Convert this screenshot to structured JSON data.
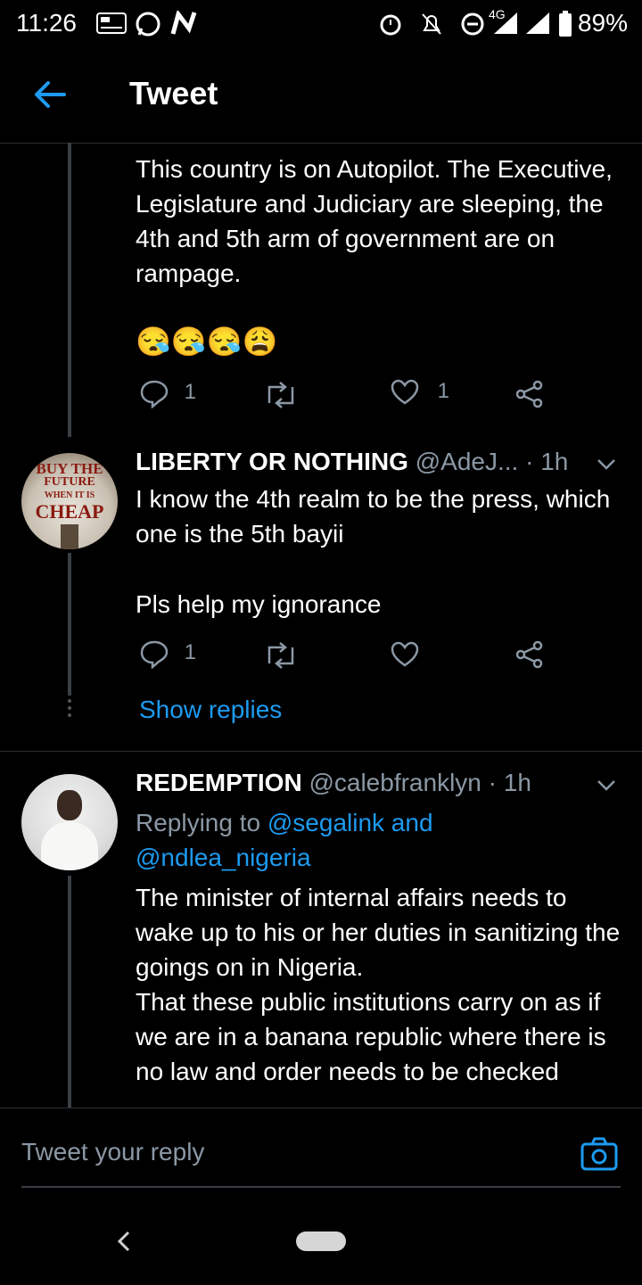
{
  "status_bar": {
    "time": "11:26",
    "network": "4G",
    "battery": "89%"
  },
  "header": {
    "title": "Tweet"
  },
  "tweet_main": {
    "text": "This country is on Autopilot. The Executive, Legislature and Judiciary are sleeping, the 4th and 5th arm of government are on rampage.",
    "emojis": "😪😪😪😩",
    "reply_count": "1",
    "like_count": "1"
  },
  "tweet_liberty": {
    "display_name": "LIBERTY OR NOTHING",
    "handle": "@AdeJ...",
    "time": "1h",
    "avatar_text": [
      "BUY THE",
      "FUTURE",
      "WHEN IT IS",
      "CHEAP"
    ],
    "text_1": "I know the 4th realm to be the press, which one is the 5th bayii",
    "text_2": "Pls help my ignorance",
    "reply_count": "1",
    "show_replies": "Show replies"
  },
  "tweet_redemption": {
    "display_name": "REDEMPTION",
    "handle": "@calebfranklyn",
    "time": "1h",
    "replying_prefix": "Replying to",
    "replying_to_1": "@segalink and",
    "replying_to_2": "@ndlea_nigeria",
    "text": "The minister of internal affairs needs to wake up to his or her duties in sanitizing the goings on in Nigeria.\nThat these public institutions carry on as if we are in a banana republic where there is no law and order needs to be checked"
  },
  "reply_bar": {
    "placeholder": "Tweet your reply"
  },
  "colors": {
    "accent": "#1d9bf0",
    "background": "#000000",
    "muted": "#8b98a5"
  },
  "icons": [
    "back-arrow-icon",
    "reply-icon",
    "retweet-icon",
    "like-icon",
    "share-icon",
    "chevron-down-icon",
    "camera-icon"
  ]
}
